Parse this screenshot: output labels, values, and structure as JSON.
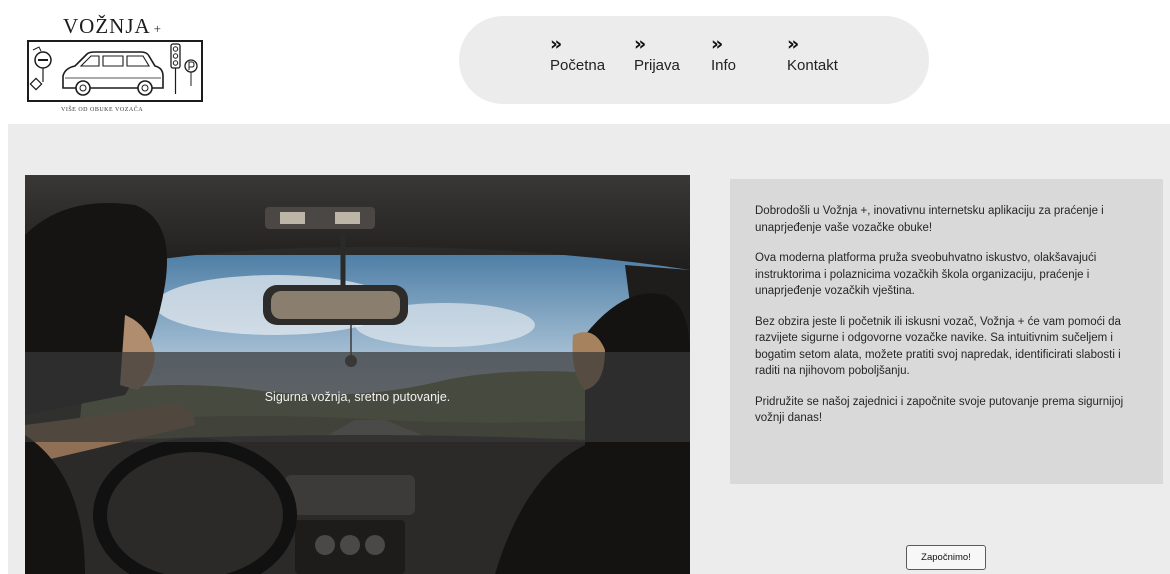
{
  "brand": {
    "title": "VOŽNJA",
    "title_suffix": "+",
    "tagline": "VIŠE OD OBUKE VOZAČA"
  },
  "nav": {
    "items": [
      {
        "label": "Početna",
        "icon": "double-chevron-right-icon"
      },
      {
        "label": "Prijava",
        "icon": "double-chevron-right-icon"
      },
      {
        "label": "Info",
        "icon": "double-chevron-right-icon"
      },
      {
        "label": "Kontakt",
        "icon": "double-chevron-right-icon"
      }
    ],
    "icon_glyph": "»"
  },
  "hero": {
    "caption": "Sigurna vožnja, sretno putovanje."
  },
  "intro": {
    "paragraphs": [
      "Dobrodošli u Vožnja +, inovativnu internetsku aplikaciju za praćenje i unaprjeđenje vaše vozačke obuke!",
      "Ova moderna platforma pruža sveobuhvatno iskustvo, olakšavajući instruktorima i polaznicima vozačkih škola organizaciju, praćenje i unaprjeđenje vozačkih vještina.",
      "Bez obzira jeste li početnik ili iskusni vozač, Vožnja + će vam pomoći da razvijete sigurne i odgovorne vozačke navike. Sa intuitivnim sučeljem i bogatim setom alata, možete pratiti svoj napredak, identificirati slabosti i raditi na njihovom poboljšanju.",
      "Pridružite se našoj zajednici i započnite svoje putovanje prema sigurnijoj vožnji danas!"
    ]
  },
  "cta": {
    "label": "Započnimo!"
  },
  "colors": {
    "header_bg": "#ffffff",
    "nav_pill_bg": "#ececec",
    "main_bg": "#ececec",
    "info_box_bg": "#d9d9d9",
    "caption_band": "#373737"
  }
}
